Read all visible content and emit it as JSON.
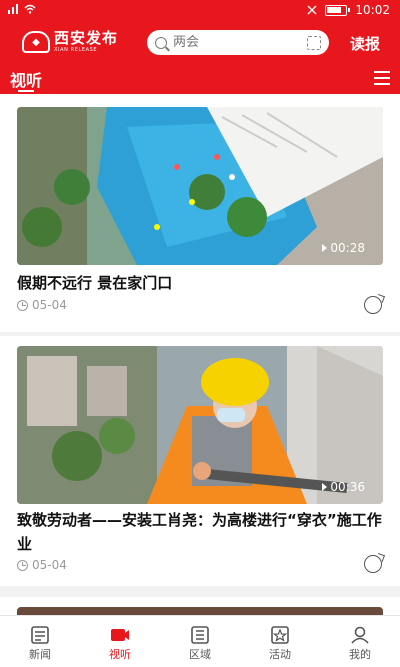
{
  "status_bar": {
    "time": "10:02"
  },
  "header": {
    "logo_cn": "西安发布",
    "logo_en": "XIAN RELEASE",
    "search_placeholder": "两会",
    "read_paper": "读报"
  },
  "tabs": {
    "active": "视听"
  },
  "feed": [
    {
      "title": "假期不远行  景在家门口",
      "date": "05-04",
      "duration": "00:28"
    },
    {
      "title": "致敬劳动者——安装工肖尧：为高楼进行“穿衣”施工作业",
      "date": "05-04",
      "duration": "00:36"
    }
  ],
  "bottom_nav": [
    {
      "label": "新闻",
      "icon": "news-icon"
    },
    {
      "label": "视听",
      "icon": "video-icon"
    },
    {
      "label": "区域",
      "icon": "region-icon"
    },
    {
      "label": "活动",
      "icon": "activity-icon"
    },
    {
      "label": "我的",
      "icon": "profile-icon"
    }
  ],
  "colors": {
    "brand_red": "#e8161d"
  }
}
